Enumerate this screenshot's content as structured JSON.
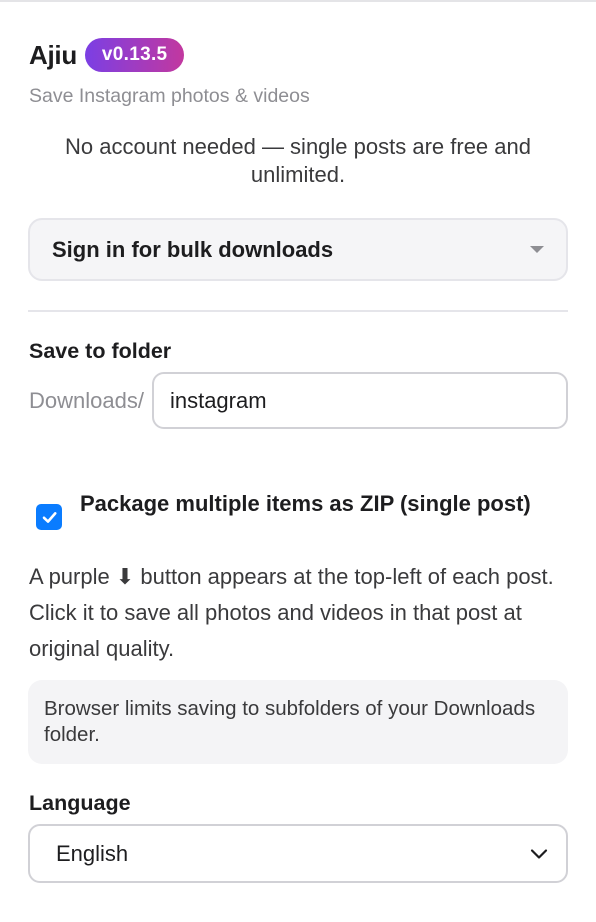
{
  "header": {
    "title": "Ajiu",
    "version": "v0.13.5",
    "subtitle": "Save Instagram photos & videos"
  },
  "notice": "No account needed — single posts are free and unlimited.",
  "signin": {
    "label": "Sign in for bulk downloads",
    "icon": "caret-down-icon"
  },
  "folder": {
    "label": "Save to folder",
    "prefix": "Downloads/",
    "value": "instagram"
  },
  "zip": {
    "checked": true,
    "label": "Package multiple items as ZIP (single post)"
  },
  "help_text": "A purple ⬇ button appears at the top-left of each post. Click it to save all photos and videos in that post at original quality.",
  "info_box": "Browser limits saving to subfolders of your Downloads folder.",
  "language": {
    "label": "Language",
    "selected": "English"
  },
  "colors": {
    "badge_gradient_start": "#7b3fe4",
    "badge_gradient_end": "#c2389f",
    "checkbox": "#0a7cff"
  }
}
